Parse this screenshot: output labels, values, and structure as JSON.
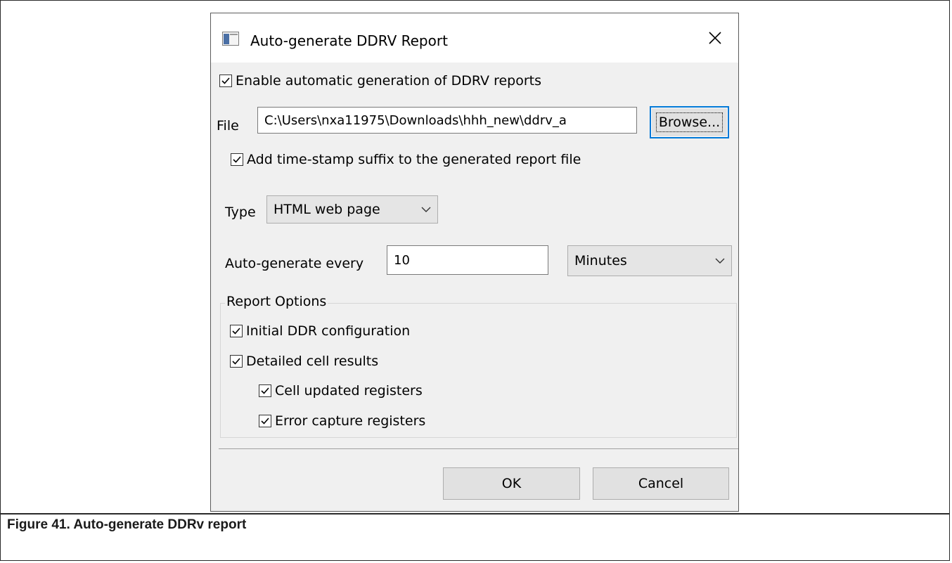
{
  "dialog": {
    "title": "Auto-generate DDRV Report",
    "enable_auto_label": "Enable automatic generation of DDRV reports",
    "file_label": "File",
    "file_value": "C:\\Users\\nxa11975\\Downloads\\hhh_new\\ddrv_a",
    "browse_label": "Browse...",
    "timestamp_label": "Add time-stamp suffix to the generated report file",
    "type_label": "Type",
    "type_selected": "HTML web page",
    "interval_label": "Auto-generate every",
    "interval_value": "10",
    "interval_unit": "Minutes",
    "report_options": {
      "legend": "Report Options",
      "initial_ddr": "Initial DDR configuration",
      "detailed_cell": "Detailed cell results",
      "cell_updated": "Cell updated registers",
      "error_capture": "Error capture registers"
    },
    "ok_label": "OK",
    "cancel_label": "Cancel"
  },
  "caption": "Figure 41. Auto-generate DDRv report",
  "colors": {
    "dialog_bg": "#f0f0f0",
    "focus_border": "#0078d7"
  }
}
